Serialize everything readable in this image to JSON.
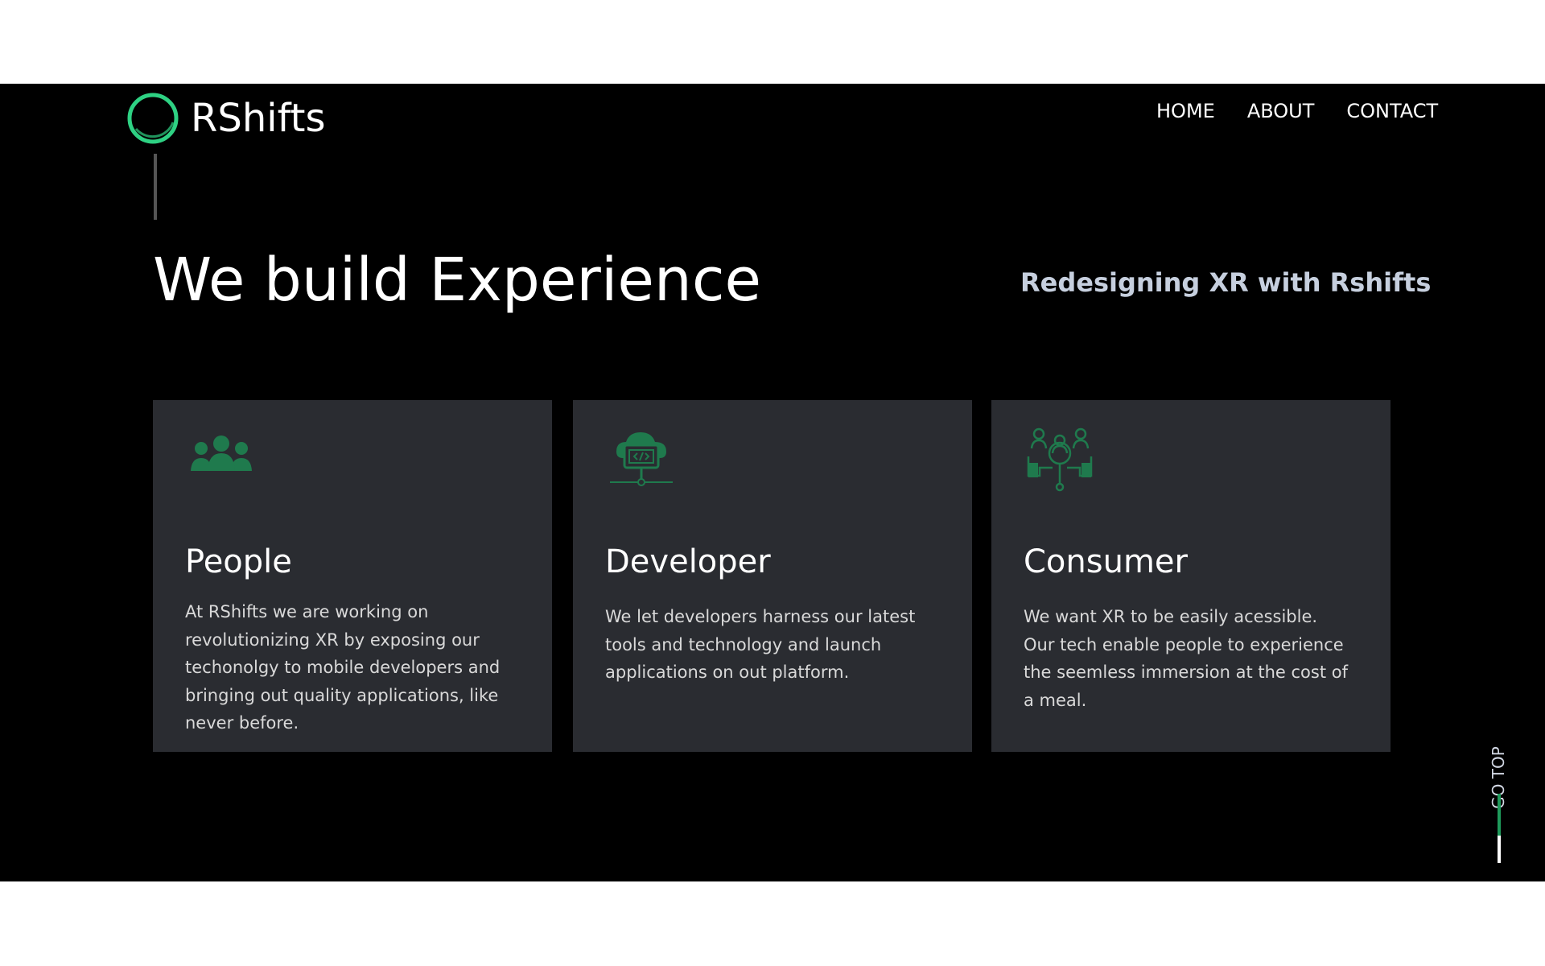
{
  "brand": {
    "name": "RShifts",
    "ring_color": "#2ed183"
  },
  "nav": {
    "items": [
      {
        "label": "HOME"
      },
      {
        "label": "ABOUT"
      },
      {
        "label": "CONTACT"
      }
    ]
  },
  "hero": {
    "title": "We build Experience",
    "subtitle": "Redesigning XR with Rshifts"
  },
  "cards": [
    {
      "icon": "people-group-icon",
      "title": "People",
      "text": "At RShifts we are working on revolutionizing XR by exposing our techonolgy to mobile developers and bringing out quality applications, like never before."
    },
    {
      "icon": "cloud-code-monitor-icon",
      "title": "Developer",
      "text": "We let developers harness our latest tools and technology and launch applications on out platform."
    },
    {
      "icon": "consumer-network-search-icon",
      "title": "Consumer",
      "text": "We want XR to be easily acessible. Our tech enable people to experience the seemless immersion at the cost of a meal."
    }
  ],
  "go_top": {
    "label": "GO TOP"
  },
  "colors": {
    "page_background": "#000000",
    "card_background": "#2a2c31",
    "icon_green": "#1f7a4d",
    "accent_green": "#1f9a5b",
    "subtitle_color": "#c6cfde"
  }
}
